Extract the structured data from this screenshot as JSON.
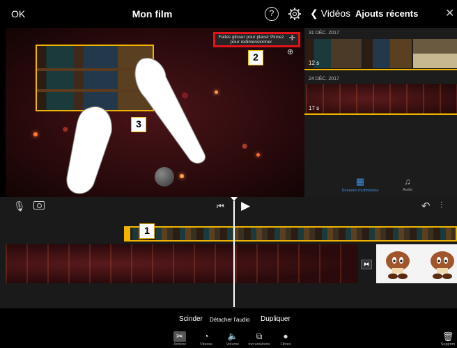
{
  "topbar": {
    "ok_label": "OK",
    "title": "Mon film",
    "help_label": "?"
  },
  "preview": {
    "hint_text": "Faites glisser pour placer Pincez pour redimensionner",
    "callouts": [
      "1",
      "2",
      "3"
    ]
  },
  "sidebar": {
    "back_label": "Vidéos",
    "title": "Ajouts récents",
    "groups": [
      {
        "date": "31 DÉC. 2017",
        "duration": "12 s"
      },
      {
        "date": "24 DÉC. 2017",
        "duration": "17 s"
      }
    ],
    "tabs": [
      {
        "label": "Données multimédias",
        "icon": "film-strip-icon",
        "active": true
      },
      {
        "label": "Audio",
        "icon": "music-note-icon",
        "active": false
      }
    ]
  },
  "actions": {
    "split": "Scinder",
    "detach": "Détacher l'audio",
    "duplicate": "Dupliquer"
  },
  "tools": [
    {
      "label": "Actions",
      "icon": "scissors-icon"
    },
    {
      "label": "Vitesse",
      "icon": "speedometer-icon"
    },
    {
      "label": "Volume",
      "icon": "speaker-icon"
    },
    {
      "label": "Incrustations",
      "icon": "overlay-icon"
    },
    {
      "label": "Filtres",
      "icon": "filters-icon"
    }
  ],
  "trash_label": "Supprim",
  "colors": {
    "accent": "#f1b500",
    "highlight": "#e3131b",
    "sidebar_active": "#3d8fe0"
  }
}
